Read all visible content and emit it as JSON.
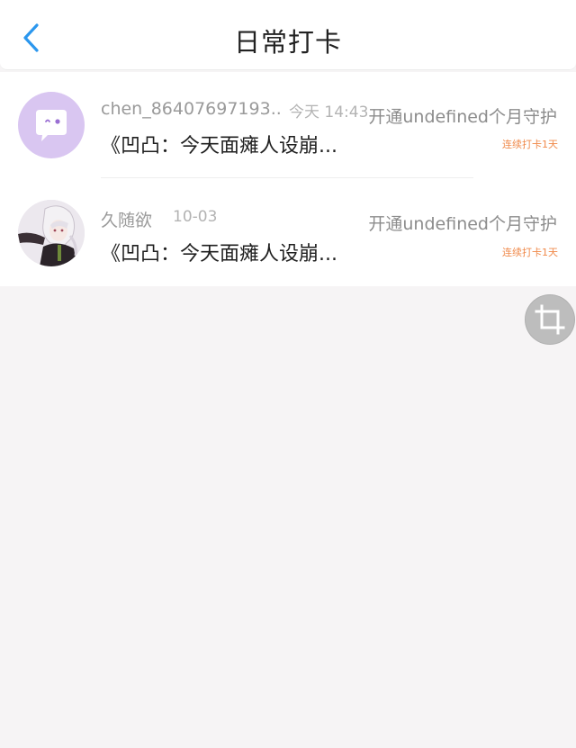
{
  "header": {
    "title": "日常打卡",
    "back_icon": "chevron-left-icon",
    "accent_color": "#2b97ee"
  },
  "items": [
    {
      "username": "chen_86407697193..",
      "time": "今天 14:43",
      "guard_text": "开通undefined个月守护",
      "title": "《凹凸：今天面瘫人设崩...",
      "streak": "连续打卡1天",
      "avatar": "default-chat-avatar-icon"
    },
    {
      "username": "久随欲",
      "time": "10-03",
      "guard_text": "开通undefined个月守护",
      "title": "《凹凸：今天面瘫人设崩...",
      "streak": "连续打卡1天",
      "avatar": "anime-character-avatar"
    }
  ],
  "floating_button": {
    "icon": "crop-icon"
  },
  "colors": {
    "streak": "#f08a4b",
    "background": "#f6f4f5"
  }
}
